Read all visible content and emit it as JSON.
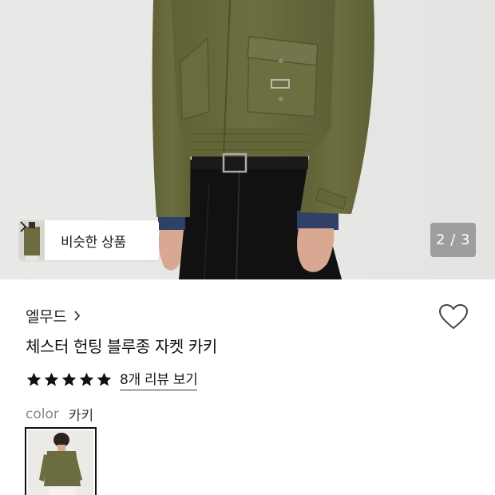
{
  "gallery": {
    "similar_label": "비슷한 상품",
    "counter": "2 / 3"
  },
  "product": {
    "brand": "엘무드",
    "title": "체스터 헌팅 블루종 자켓 카키",
    "review_link": "8개 리뷰 보기",
    "rating_stars": 5,
    "color_label": "color",
    "color_value": "카키"
  },
  "colors": {
    "jacket": "#6b6b3e",
    "star": "#111111"
  },
  "icons": {
    "wishlist": "heart-outline-icon",
    "brand_chevron": "chevron-right-icon",
    "similar_chevron": "chevron-right-icon"
  }
}
